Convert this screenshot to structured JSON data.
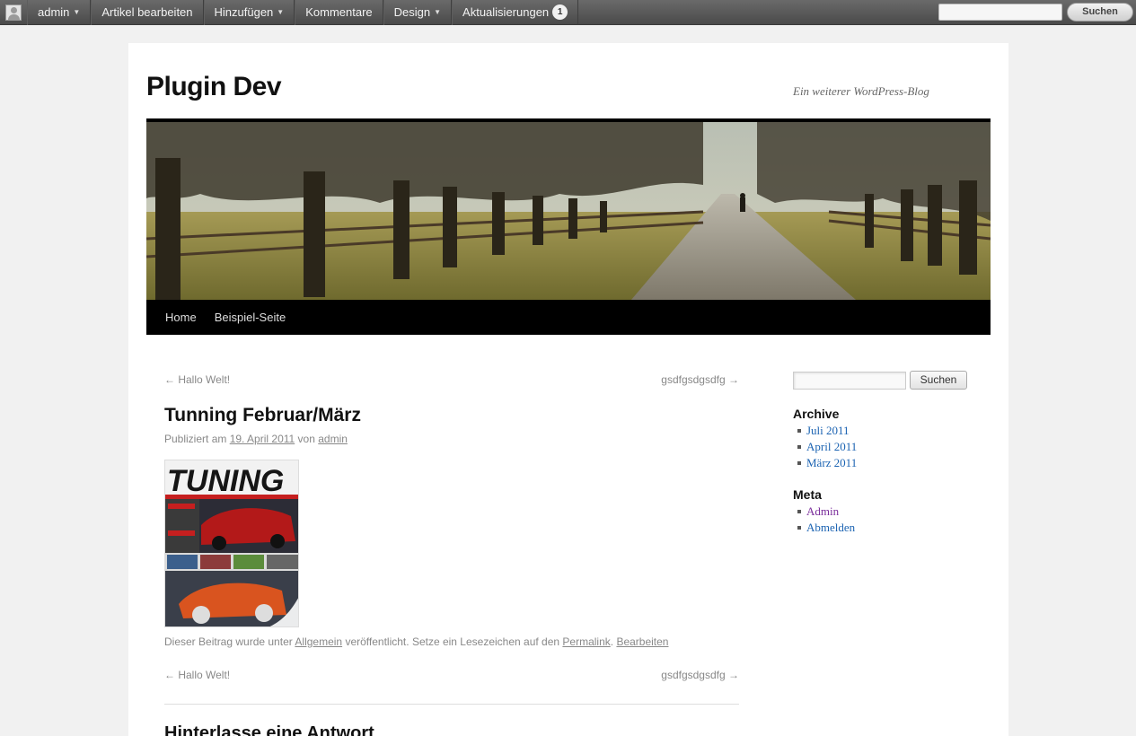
{
  "adminbar": {
    "user": "admin",
    "items": [
      "Artikel bearbeiten",
      "Hinzufügen",
      "Kommentare",
      "Design",
      "Aktualisierungen"
    ],
    "updates_count": "1",
    "search_button": "Suchen"
  },
  "site": {
    "title": "Plugin Dev",
    "description": "Ein weiterer WordPress-Blog"
  },
  "menu": [
    "Home",
    "Beispiel-Seite"
  ],
  "post_nav": {
    "prev": "← Hallo Welt!",
    "next": "gsdfgsdgsdfg →"
  },
  "post": {
    "title": "Tunning Februar/März",
    "meta_prefix": "Publiziert am",
    "date": "19. April 2011",
    "meta_by": "von",
    "author": "admin",
    "thumb_text": "TUNING",
    "util_prefix": "Dieser Beitrag wurde unter",
    "category": "Allgemein",
    "util_middle": "veröffentlicht. Setze ein Lesezeichen auf den",
    "permalink": "Permalink",
    "edit": "Bearbeiten"
  },
  "comments": {
    "reply_title": "Hinterlasse eine Antwort"
  },
  "sidebar": {
    "search_button": "Suchen",
    "archive_title": "Archive",
    "archives": [
      "Juli 2011",
      "April 2011",
      "März 2011"
    ],
    "meta_title": "Meta",
    "meta_links": [
      "Admin",
      "Abmelden"
    ]
  },
  "colors": {
    "link": "#1b63b2",
    "visited_link": "#7a2d9b",
    "menu_bar": "#000000",
    "admin_bar": "#555555"
  }
}
